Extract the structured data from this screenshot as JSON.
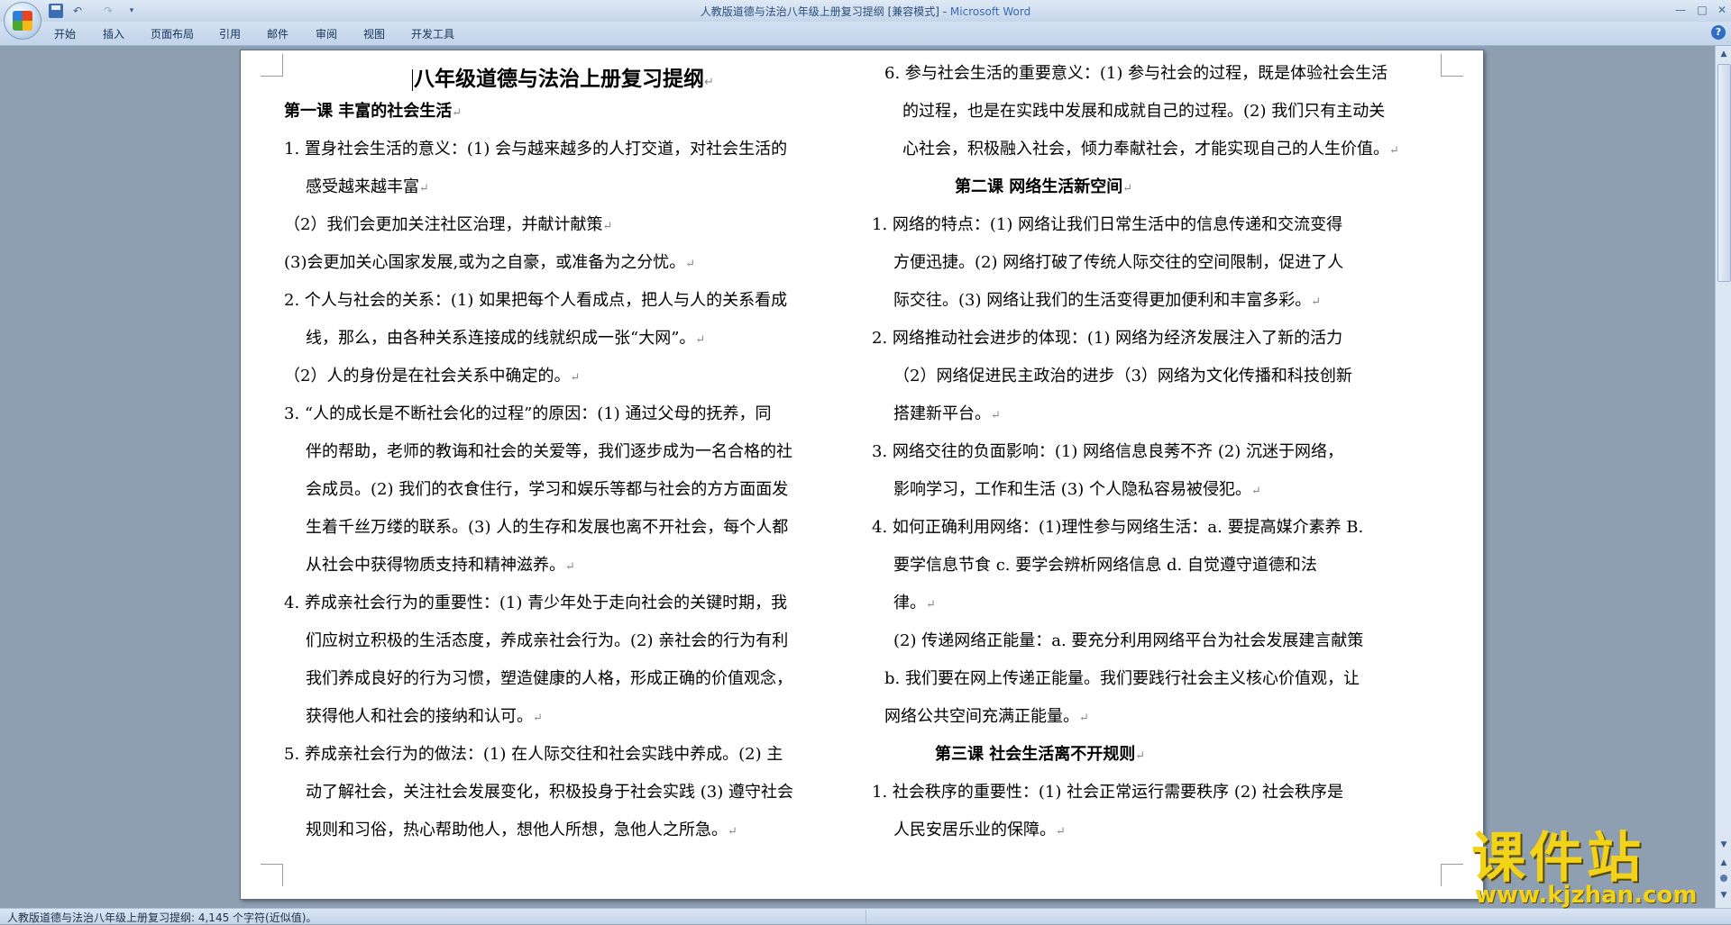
{
  "window": {
    "title_doc": "人教版道德与法治八年级上册复习提纲 [兼容模式] - ",
    "title_app": "Microsoft Word",
    "help_glyph": "?"
  },
  "quick_access": {
    "undo": "↶",
    "redo": "↷",
    "dropdown": "▾"
  },
  "ribbon": {
    "tabs": [
      "开始",
      "插入",
      "页面布局",
      "引用",
      "邮件",
      "审阅",
      "视图",
      "开发工具"
    ]
  },
  "document": {
    "left_column": [
      "八年级道德与法治上册复习提纲",
      "第一课  丰富的社会生活",
      "1. 置身社会生活的意义：(1) 会与越来越多的人打交道，对社会生活的",
      "感受越来越丰富",
      "（2）我们会更加关注社区治理，并献计献策",
      "(3)会更加关心国家发展,或为之自豪，或准备为之分忧。",
      "2. 个人与社会的关系：(1) 如果把每个人看成点，把人与人的关系看成",
      "线，那么，由各种关系连接成的线就织成一张“大网”。",
      "（2）人的身份是在社会关系中确定的。",
      "3. “人的成长是不断社会化的过程”的原因：(1) 通过父母的抚养，同",
      "伴的帮助，老师的教诲和社会的关爱等，我们逐步成为一名合格的社",
      "会成员。(2) 我们的衣食住行，学习和娱乐等都与社会的方方面面发",
      "生着千丝万缕的联系。(3) 人的生存和发展也离不开社会，每个人都",
      "从社会中获得物质支持和精神滋养。",
      "4. 养成亲社会行为的重要性：(1) 青少年处于走向社会的关键时期，我",
      "们应树立积极的生活态度，养成亲社会行为。(2) 亲社会的行为有利",
      "我们养成良好的行为习惯，塑造健康的人格，形成正确的价值观念，",
      "获得他人和社会的接纳和认可。",
      "5. 养成亲社会行为的做法：(1) 在人际交往和社会实践中养成。(2) 主",
      "动了解社会，关注社会发展变化，积极投身于社会实践 (3) 遵守社会",
      "规则和习俗，热心帮助他人，想他人所想，急他人之所急。"
    ],
    "right_column": [
      "6. 参与社会生活的重要意义：(1) 参与社会的过程，既是体验社会生活",
      "的过程，也是在实践中发展和成就自己的过程。(2) 我们只有主动关",
      "心社会，积极融入社会，倾力奉献社会，才能实现自己的人生价值。",
      "第二课   网络生活新空间",
      "1. 网络的特点：(1) 网络让我们日常生活中的信息传递和交流变得",
      "方便迅捷。(2) 网络打破了传统人际交往的空间限制，促进了人",
      "际交往。(3) 网络让我们的生活变得更加便利和丰富多彩。",
      "2. 网络推动社会进步的体现：(1) 网络为经济发展注入了新的活力",
      "（2）网络促进民主政治的进步（3）网络为文化传播和科技创新",
      "搭建新平台。",
      "3. 网络交往的负面影响：(1) 网络信息良莠不齐 (2) 沉迷于网络，",
      "影响学习，工作和生活 (3) 个人隐私容易被侵犯。",
      "4. 如何正确利用网络：(1)理性参与网络生活：a.  要提高媒介素养  B.",
      "要学信息节食    c. 要学会辨析网络信息    d. 自觉遵守道德和法",
      "律。",
      "(2) 传递网络正能量：a. 要充分利用网络平台为社会发展建言献策",
      "b. 我们要在网上传递正能量。我们要践行社会主义核心价值观，让",
      "网络公共空间充满正能量。",
      "第三课   社会生活离不开规则",
      "1. 社会秩序的重要性：(1) 社会正常运行需要秩序 (2) 社会秩序是",
      "人民安居乐业的保障。"
    ]
  },
  "status": {
    "text": "人教版道德与法治八年级上册复习提纲: 4,145 个字符(近似值)。"
  },
  "watermark": {
    "title": "课件站",
    "url": "www.kjzhan.com"
  }
}
